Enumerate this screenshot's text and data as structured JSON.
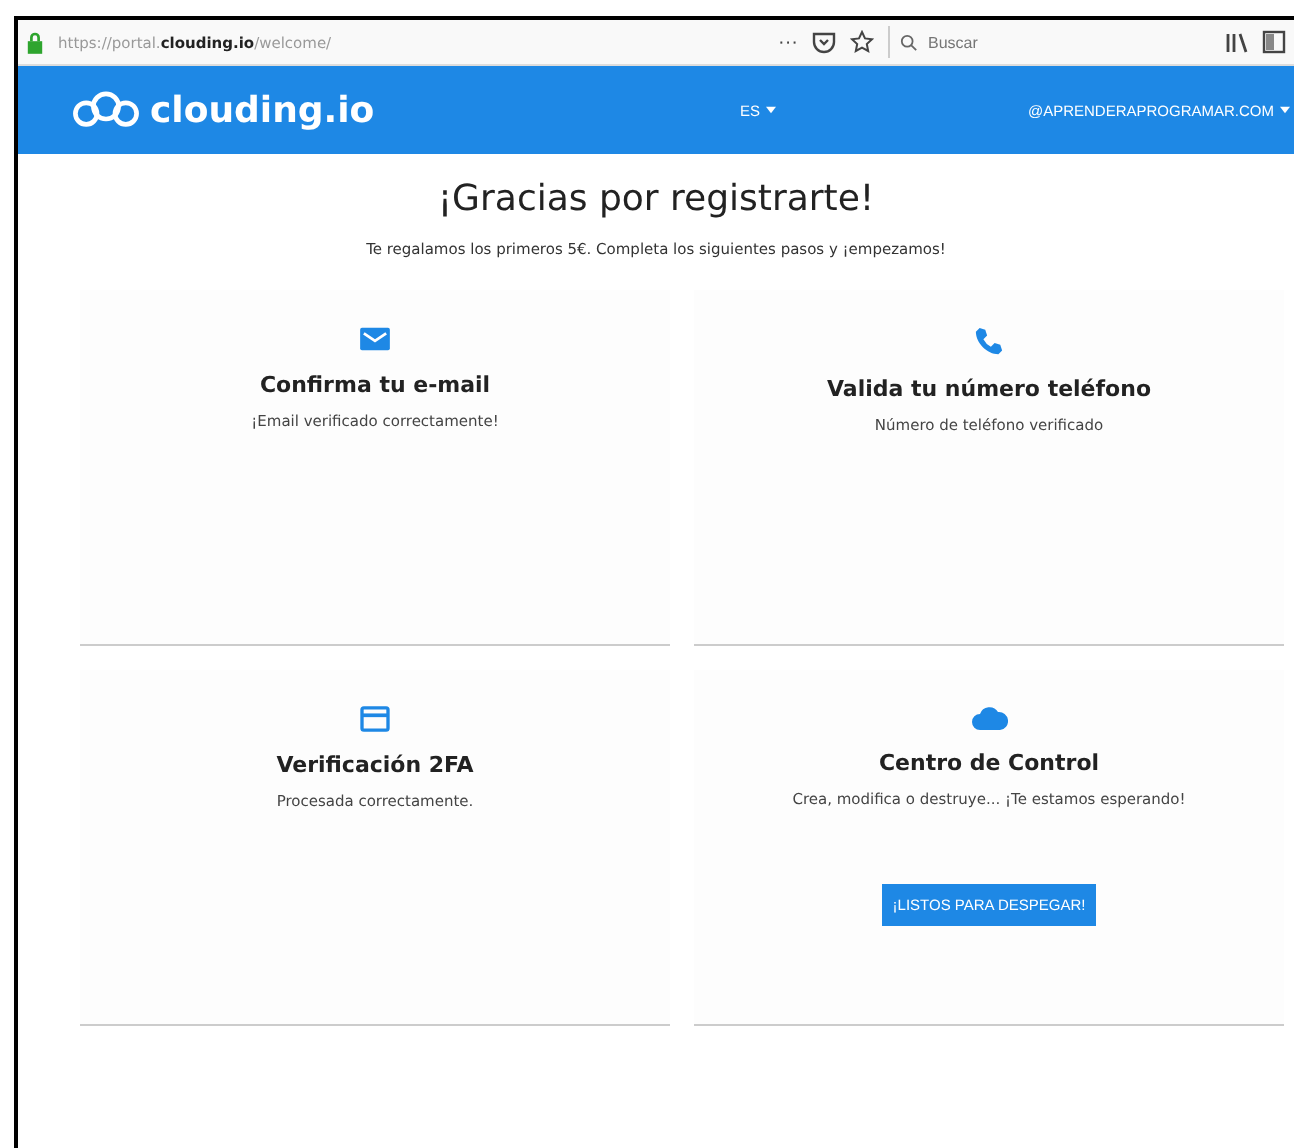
{
  "browser": {
    "url_prefix": "https://portal.",
    "url_domain": "clouding.io",
    "url_suffix": "/welcome/",
    "menu": "···",
    "search": {
      "placeholder": "Buscar"
    }
  },
  "header": {
    "logo": "clouding.io",
    "language": "ES",
    "account": "@APRENDERAPROGRAMAR.COM"
  },
  "title": "¡Gracias por registrarte!",
  "subtitle": "Te regalamos los primeros 5€. Completa los siguientes pasos y ¡empezamos!",
  "cards": [
    {
      "kind": "mail",
      "title": "Confirma tu e-mail",
      "text": "¡Email verificado correctamente!"
    },
    {
      "kind": "phone",
      "title": "Valida tu número teléfono",
      "text": "Número de teléfono verificado"
    },
    {
      "kind": "card",
      "title": "Verificación 2FA",
      "text": "Procesada correctamente."
    },
    {
      "kind": "cloud",
      "title": "Centro de Control",
      "text": "Crea, modifica o destruye... ¡Te estamos esperando!",
      "button": "¡LISTOS PARA DESPEGAR!"
    }
  ]
}
